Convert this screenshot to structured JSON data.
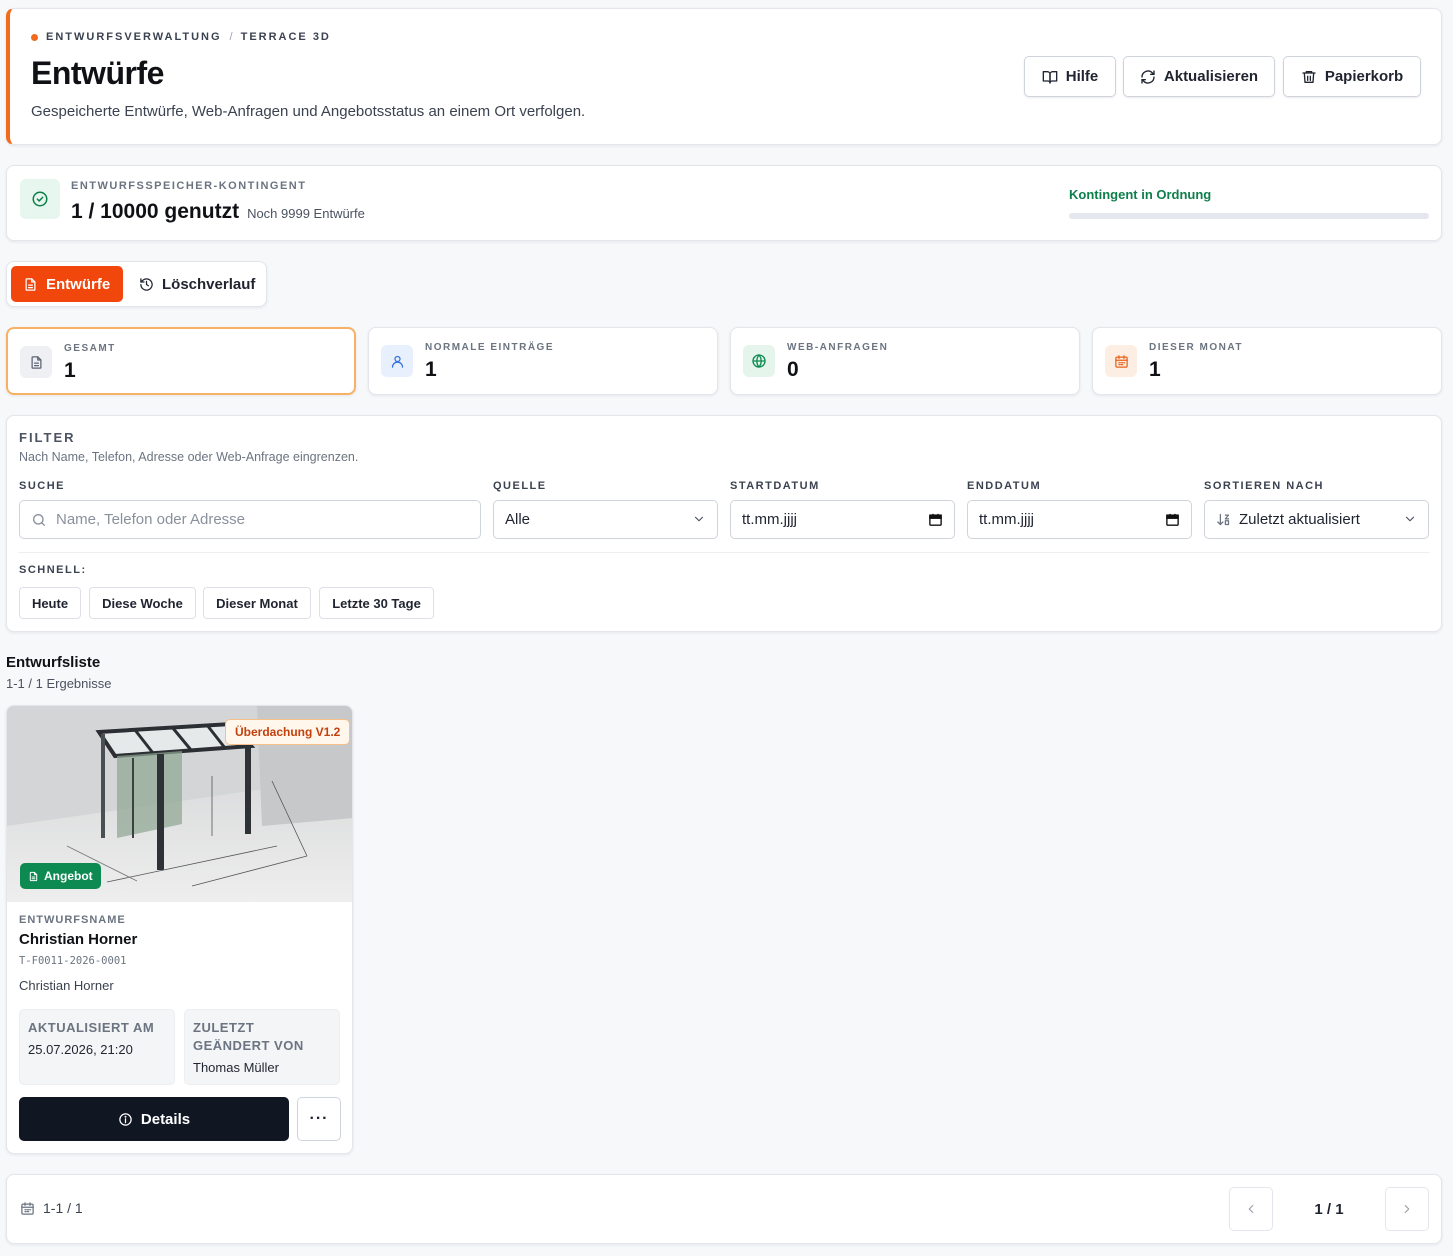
{
  "header": {
    "breadcrumb": [
      "ENTWURFSVERWALTUNG",
      "TERRACE 3D"
    ],
    "title": "Entwürfe",
    "subtitle": "Gespeicherte Entwürfe, Web-Anfragen und Angebotsstatus an einem Ort verfolgen.",
    "buttons": {
      "help": "Hilfe",
      "refresh": "Aktualisieren",
      "trash": "Papierkorb"
    }
  },
  "quota": {
    "label": "ENTWURFSSPEICHER-KONTINGENT",
    "used_text": "1 / 10000 genutzt",
    "remaining_text": "Noch 9999 Entwürfe",
    "status": "Kontingent in Ordnung",
    "used_fraction": 0.0001
  },
  "tabs": [
    {
      "label": "Entwürfe",
      "active": true
    },
    {
      "label": "Löschverlauf",
      "active": false
    }
  ],
  "stats": [
    {
      "label": "GESAMT",
      "value": "1"
    },
    {
      "label": "NORMALE EINTRÄGE",
      "value": "1"
    },
    {
      "label": "WEB-ANFRAGEN",
      "value": "0"
    },
    {
      "label": "DIESER MONAT",
      "value": "1"
    }
  ],
  "filter": {
    "title": "FILTER",
    "subtitle": "Nach Name, Telefon, Adresse oder Web-Anfrage eingrenzen.",
    "search_label": "SUCHE",
    "search_placeholder": "Name, Telefon oder Adresse",
    "source_label": "QUELLE",
    "source_value": "Alle",
    "start_label": "STARTDATUM",
    "start_value": "tt.mm.jjjj",
    "end_label": "ENDDATUM",
    "end_value": "tt.mm.jjjj",
    "sort_label": "SORTIEREN NACH",
    "sort_value": "Zuletzt aktualisiert",
    "quick_label": "SCHNELL:",
    "quick": [
      "Heute",
      "Diese Woche",
      "Dieser Monat",
      "Letzte 30 Tage"
    ]
  },
  "list": {
    "title": "Entwurfsliste",
    "count": "1-1 / 1 Ergebnisse"
  },
  "draft": {
    "version_badge": "Überdachung V1.2",
    "offer_badge": "Angebot",
    "name_label": "ENTWURFSNAME",
    "name": "Christian Horner",
    "id": "T-F0011-2026-0001",
    "customer": "Christian Horner",
    "updated_label": "AKTUALISIERT AM",
    "updated_value": "25.07.2026, 21:20",
    "changed_label": "ZULETZT GEÄNDERT VON",
    "changed_value": "Thomas Müller",
    "details_button": "Details",
    "more_button": "···"
  },
  "pager": {
    "info": "1-1 / 1",
    "current": "1 / 1"
  },
  "colors": {
    "accent": "#f2470c",
    "header_accent": "#f26a1b",
    "success": "#0d7f4a",
    "dark_button": "#111623"
  }
}
